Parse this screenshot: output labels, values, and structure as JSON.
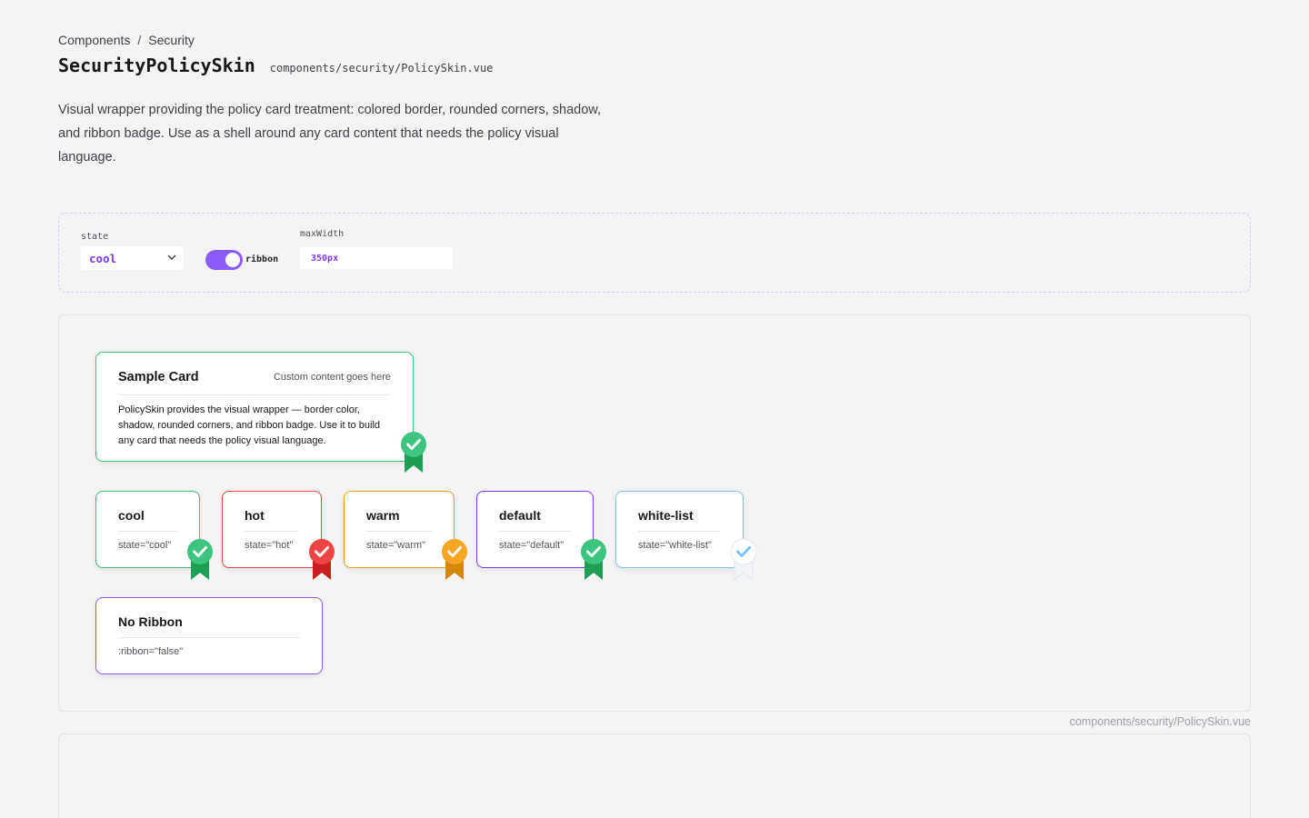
{
  "breadcrumb": {
    "parent": "Components",
    "separator": "/",
    "current": "Security"
  },
  "header": {
    "title": "SecurityPolicySkin",
    "file_path": "components/security/PolicySkin.vue"
  },
  "description": "Visual wrapper providing the policy card treatment: colored border, rounded corners, shadow, and ribbon badge. Use as a shell around any card content that needs the policy visual language.",
  "controls": {
    "state": {
      "label": "state",
      "value": "cool"
    },
    "ribbon": {
      "label": "ribbon",
      "enabled": true
    },
    "max_width": {
      "label": "maxWidth",
      "value": "350px"
    }
  },
  "sample_card": {
    "title": "Sample Card",
    "hint": "Custom content goes here",
    "body": "PolicySkin provides the visual wrapper — border color, shadow, rounded corners, and ribbon badge. Use it to build any card that needs the policy visual language."
  },
  "variant_cards": [
    {
      "title": "cool",
      "subtitle": "state=\"cool\"",
      "border": "#3cc07a",
      "badge": "#3fc380",
      "tail": "#1e9f55"
    },
    {
      "title": "hot",
      "subtitle": "state=\"hot\"",
      "border": "#ef4444",
      "badge": "#ef4444",
      "tail": "#c81e1e"
    },
    {
      "title": "warm",
      "subtitle": "state=\"warm\"",
      "border": "#f59e0b",
      "badge": "#f5a623",
      "tail": "#d48806"
    },
    {
      "title": "default",
      "subtitle": "state=\"default\"",
      "border": "#7c3aed",
      "badge": "#3fc380",
      "tail": "#1e9f55"
    },
    {
      "title": "white-list",
      "subtitle": "state=\"white-list\"",
      "border": "#7cc4f0",
      "badge": "#ffffff",
      "tail": "#f1f5f9"
    }
  ],
  "no_ribbon_card": {
    "title": "No Ribbon",
    "subtitle": ":ribbon=\"false\"",
    "border": "#8b5cf6"
  },
  "footer": {
    "file_path": "components/security/PolicySkin.vue"
  },
  "colors": {
    "accent": "#8b5cf6",
    "cool": "#3cc07a",
    "hot": "#ef4444",
    "warm": "#f59e0b",
    "default": "#7c3aed",
    "white_list": "#7cc4f0"
  }
}
